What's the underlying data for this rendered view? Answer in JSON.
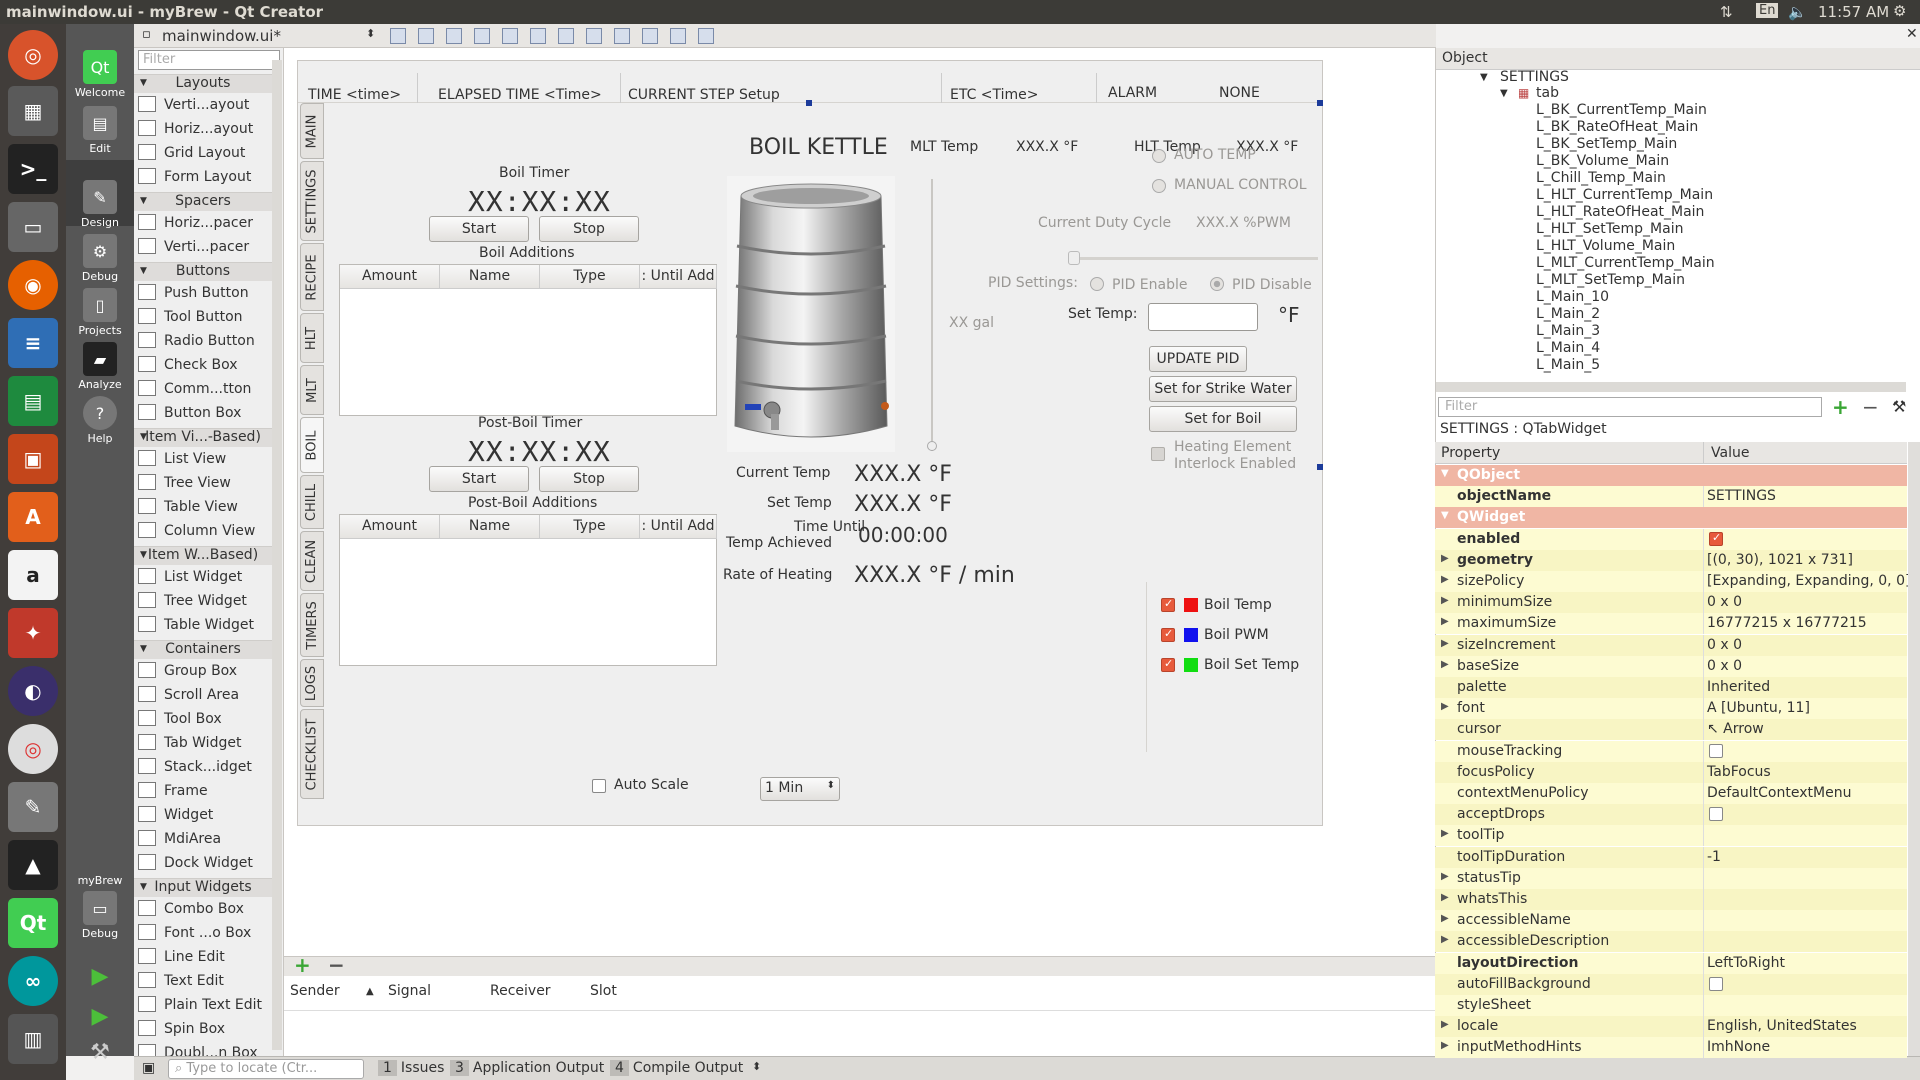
{
  "system": {
    "window_title": "mainwindow.ui - myBrew - Qt Creator",
    "clock": "11:57 AM",
    "keyboard": "En"
  },
  "modes": [
    {
      "label": "Welcome"
    },
    {
      "label": "Edit"
    },
    {
      "label": "Design"
    },
    {
      "label": "Debug"
    },
    {
      "label": "Projects"
    },
    {
      "label": "Analyze"
    },
    {
      "label": "Help"
    }
  ],
  "target": {
    "project": "myBrew",
    "config": "Debug"
  },
  "editor": {
    "file_name": "mainwindow.ui*"
  },
  "widget_box": {
    "filter_placeholder": "Filter",
    "categories": [
      {
        "name": "Layouts",
        "items": [
          "Verti...ayout",
          "Horiz...ayout",
          "Grid Layout",
          "Form Layout"
        ]
      },
      {
        "name": "Spacers",
        "items": [
          "Horiz...pacer",
          "Verti...pacer"
        ]
      },
      {
        "name": "Buttons",
        "items": [
          "Push Button",
          "Tool Button",
          "Radio Button",
          "Check Box",
          "Comm...tton",
          "Button Box"
        ]
      },
      {
        "name": "Item Vi...-Based)",
        "items": [
          "List View",
          "Tree View",
          "Table View",
          "Column View"
        ]
      },
      {
        "name": "Item W...Based)",
        "items": [
          "List Widget",
          "Tree Widget",
          "Table Widget"
        ]
      },
      {
        "name": "Containers",
        "items": [
          "Group Box",
          "Scroll Area",
          "Tool Box",
          "Tab Widget",
          "Stack...idget",
          "Frame",
          "Widget",
          "MdiArea",
          "Dock Widget"
        ]
      },
      {
        "name": "Input Widgets",
        "items": [
          "Combo Box",
          "Font ...o Box",
          "Line Edit",
          "Text Edit",
          "Plain Text Edit",
          "Spin Box",
          "Doubl...n Box"
        ]
      }
    ]
  },
  "form": {
    "header": {
      "time": "TIME  <time>",
      "elapsed": "ELAPSED TIME  <Time>",
      "step": "CURRENT STEP  Setup",
      "etc": "ETC <Time>",
      "alarm": "ALARM",
      "alarm_val": "NONE"
    },
    "tabs": [
      "MAIN",
      "SETTINGS",
      "RECIPE",
      "HLT",
      "MLT",
      "BOIL",
      "CHILL",
      "CLEAN",
      "TIMERS",
      "LOGS",
      "CHECKLIST"
    ],
    "mlt_temp_label": "MLT Temp",
    "mlt_temp_val": "XXX.X  °F",
    "hlt_temp_label": "HLT Temp",
    "hlt_temp_val": "XXX.X  °F",
    "kettle_title": "BOIL KETTLE",
    "boil_timer": {
      "label": "Boil Timer",
      "value": "XX:XX:XX",
      "start": "Start",
      "stop": "Stop"
    },
    "boil_additions": {
      "label": "Boil Additions",
      "columns": [
        "Amount",
        "Name",
        "Type",
        ": Until Add"
      ]
    },
    "post_boil_timer": {
      "label": "Post-Boil Timer",
      "value": "XX:XX:XX",
      "start": "Start",
      "stop": "Stop"
    },
    "post_boil_additions": {
      "label": "Post-Boil Additions",
      "columns": [
        "Amount",
        "Name",
        "Type",
        ": Until Add"
      ]
    },
    "readouts": {
      "current_temp_label": "Current Temp",
      "current_temp": "XXX.X °F",
      "set_temp_label": "Set Temp",
      "set_temp": "XXX.X °F",
      "time_until_l1": "Time Until",
      "time_until_l2": "Temp Achieved",
      "time_until": "00:00:00",
      "rate_label": "Rate of Heating",
      "rate": "XXX.X °F / min",
      "volume": "XX gal"
    },
    "control": {
      "auto_temp": "AUTO TEMP",
      "manual": "MANUAL CONTROL",
      "duty_label": "Current Duty Cycle",
      "duty_val": "XXX.X  %PWM",
      "pid_label": "PID Settings:",
      "pid_enable": "PID Enable",
      "pid_disable": "PID Disable",
      "set_temp_label": "Set Temp:",
      "set_temp_unit": "°F",
      "update_pid": "UPDATE PID",
      "strike": "Set for Strike Water",
      "boil": "Set for Boil",
      "interlock_l1": "Heating Element",
      "interlock_l2": "Interlock Enabled"
    },
    "legend": [
      {
        "name": "Boil Temp",
        "color": "#ee1111"
      },
      {
        "name": "Boil PWM",
        "color": "#1111ee"
      },
      {
        "name": "Boil Set Temp",
        "color": "#11dd11"
      }
    ],
    "auto_scale": "Auto Scale",
    "scale_select": "1 Min"
  },
  "signals": {
    "columns": [
      "Sender",
      "Signal",
      "Receiver",
      "Slot"
    ]
  },
  "object_inspector": {
    "header": "Object",
    "root": "SETTINGS",
    "child": "tab",
    "items": [
      "L_BK_CurrentTemp_Main",
      "L_BK_RateOfHeat_Main",
      "L_BK_SetTemp_Main",
      "L_BK_Volume_Main",
      "L_Chill_Temp_Main",
      "L_HLT_CurrentTemp_Main",
      "L_HLT_RateOfHeat_Main",
      "L_HLT_SetTemp_Main",
      "L_HLT_Volume_Main",
      "L_MLT_CurrentTemp_Main",
      "L_MLT_SetTemp_Main",
      "L_Main_10",
      "L_Main_2",
      "L_Main_3",
      "L_Main_4",
      "L_Main_5"
    ]
  },
  "property_editor": {
    "filter_placeholder": "Filter",
    "title": "SETTINGS : QTabWidget",
    "col_property": "Property",
    "col_value": "Value",
    "rows": [
      {
        "name": "QObject",
        "value": "",
        "kind": "grp"
      },
      {
        "name": "objectName",
        "value": "SETTINGS",
        "kind": "y",
        "bold": true
      },
      {
        "name": "QWidget",
        "value": "",
        "kind": "grp"
      },
      {
        "name": "enabled",
        "value": "",
        "kind": "y",
        "bold": true,
        "check": "on"
      },
      {
        "name": "geometry",
        "value": "[(0, 30), 1021 x 731]",
        "kind": "y2",
        "bold": true,
        "arrow": true
      },
      {
        "name": "sizePolicy",
        "value": "[Expanding, Expanding, 0, 0]",
        "kind": "y",
        "arrow": true
      },
      {
        "name": "minimumSize",
        "value": "0 x 0",
        "kind": "y2",
        "arrow": true
      },
      {
        "name": "maximumSize",
        "value": "16777215 x 16777215",
        "kind": "y",
        "arrow": true
      },
      {
        "name": "sizeIncrement",
        "value": "0 x 0",
        "kind": "y2",
        "arrow": true
      },
      {
        "name": "baseSize",
        "value": "0 x 0",
        "kind": "y",
        "arrow": true
      },
      {
        "name": "palette",
        "value": "Inherited",
        "kind": "y2"
      },
      {
        "name": "font",
        "value": "A  [Ubuntu, 11]",
        "kind": "y",
        "arrow": true
      },
      {
        "name": "cursor",
        "value": "↖  Arrow",
        "kind": "y2"
      },
      {
        "name": "mouseTracking",
        "value": "",
        "kind": "y",
        "check": "off"
      },
      {
        "name": "focusPolicy",
        "value": "TabFocus",
        "kind": "y2"
      },
      {
        "name": "contextMenuPolicy",
        "value": "DefaultContextMenu",
        "kind": "y"
      },
      {
        "name": "acceptDrops",
        "value": "",
        "kind": "y2",
        "check": "off"
      },
      {
        "name": "toolTip",
        "value": "",
        "kind": "y",
        "arrow": true
      },
      {
        "name": "toolTipDuration",
        "value": "-1",
        "kind": "y2"
      },
      {
        "name": "statusTip",
        "value": "",
        "kind": "y",
        "arrow": true
      },
      {
        "name": "whatsThis",
        "value": "",
        "kind": "y2",
        "arrow": true
      },
      {
        "name": "accessibleName",
        "value": "",
        "kind": "y",
        "arrow": true
      },
      {
        "name": "accessibleDescription",
        "value": "",
        "kind": "y2",
        "arrow": true
      },
      {
        "name": "layoutDirection",
        "value": "LeftToRight",
        "kind": "y",
        "bold": true
      },
      {
        "name": "autoFillBackground",
        "value": "",
        "kind": "y2",
        "check": "off"
      },
      {
        "name": "styleSheet",
        "value": "",
        "kind": "y"
      },
      {
        "name": "locale",
        "value": "English, UnitedStates",
        "kind": "y2",
        "arrow": true
      },
      {
        "name": "inputMethodHints",
        "value": "ImhNone",
        "kind": "y",
        "arrow": true
      }
    ]
  },
  "bottom_bar": {
    "locate_placeholder": "Type to locate (Ctr...",
    "panes": [
      {
        "n": "1",
        "label": "Issues"
      },
      {
        "n": "3",
        "label": "Application Output"
      },
      {
        "n": "4",
        "label": "Compile Output"
      }
    ]
  }
}
